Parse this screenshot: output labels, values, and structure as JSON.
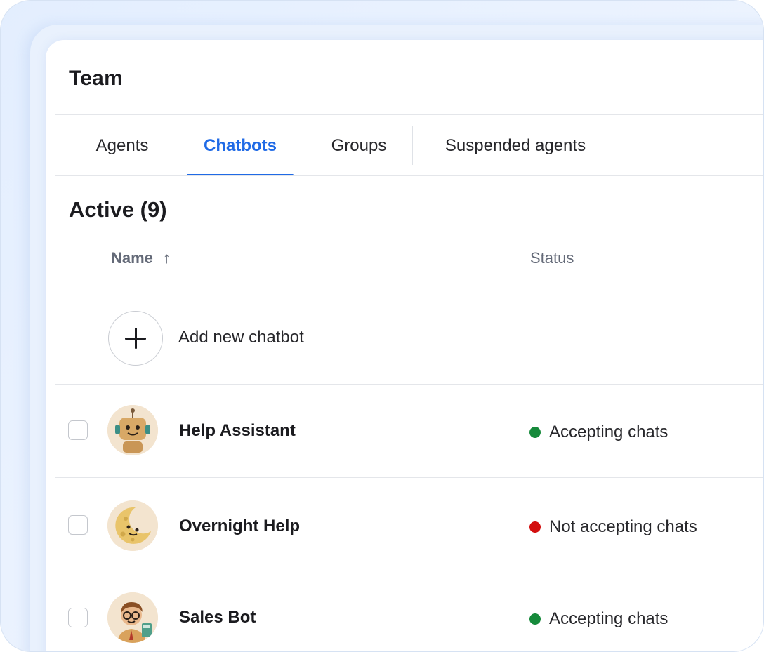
{
  "page": {
    "title": "Team"
  },
  "tabs": [
    {
      "label": "Agents",
      "active": false
    },
    {
      "label": "Chatbots",
      "active": true
    },
    {
      "label": "Groups",
      "active": false
    },
    {
      "label": "Suspended agents",
      "active": false
    }
  ],
  "section": {
    "title": "Active (9)"
  },
  "table": {
    "columns": {
      "name": "Name",
      "status": "Status"
    },
    "sort_icon": "↑",
    "add_label": "Add new chatbot",
    "rows": [
      {
        "name": "Help Assistant",
        "status": "Accepting chats",
        "status_color": "#168a3b",
        "avatar": "robot-avatar-icon"
      },
      {
        "name": "Overnight Help",
        "status": "Not accepting chats",
        "status_color": "#d30f0f",
        "avatar": "moon-avatar-icon"
      },
      {
        "name": "Sales Bot",
        "status": "Accepting chats",
        "status_color": "#168a3b",
        "avatar": "salesman-avatar-icon"
      }
    ]
  },
  "colors": {
    "accent": "#1f6ae6",
    "online": "#168a3b",
    "offline": "#d30f0f"
  }
}
